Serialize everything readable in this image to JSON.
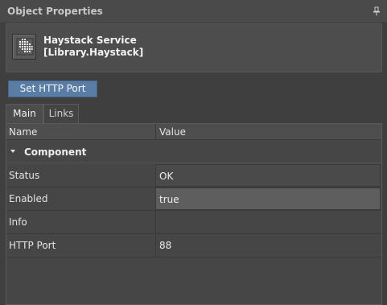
{
  "panel": {
    "title": "Object Properties",
    "pin_icon": "pin-icon"
  },
  "object": {
    "name": "Haystack Service",
    "type": "[Library.Haystack]",
    "icon": "haystack-service-icon"
  },
  "actions": {
    "set_http_port": "Set HTTP Port"
  },
  "tabs": [
    {
      "label": "Main",
      "active": true
    },
    {
      "label": "Links",
      "active": false
    }
  ],
  "grid": {
    "headers": {
      "name": "Name",
      "value": "Value"
    },
    "group": "Component",
    "rows": [
      {
        "name": "Status",
        "value": "OK"
      },
      {
        "name": "Enabled",
        "value": "true"
      },
      {
        "name": "Info",
        "value": ""
      },
      {
        "name": "HTTP Port",
        "value": "88"
      }
    ]
  },
  "colors": {
    "accent": "#5a7da6",
    "background": "#3f3f3f",
    "panel": "#464646"
  }
}
